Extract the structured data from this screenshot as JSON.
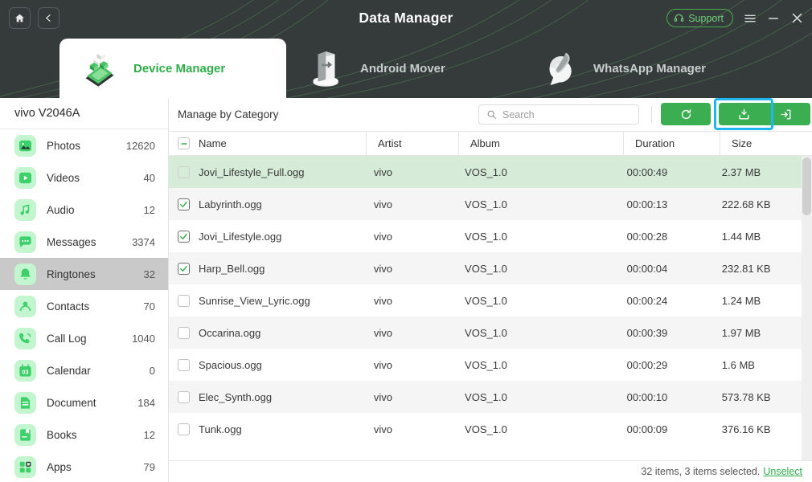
{
  "window": {
    "title": "Data Manager",
    "home_icon": "home-icon",
    "back_icon": "chevron-left-icon",
    "support_label": "Support",
    "support_icon": "headset-icon",
    "menu_icon": "hamburger-icon",
    "minimize_icon": "minimize-icon",
    "close_icon": "close-icon",
    "accent": "#3cae52",
    "header_bg": "#353a3b"
  },
  "tabs": [
    {
      "label": "Device Manager",
      "icon": "phone-cubes-icon",
      "active": true
    },
    {
      "label": "Android Mover",
      "icon": "folder-transfer-icon",
      "active": false
    },
    {
      "label": "WhatsApp Manager",
      "icon": "whatsapp-phone-icon",
      "active": false
    }
  ],
  "sidebar": {
    "device_name": "vivo V2046A",
    "items": [
      {
        "label": "Photos",
        "count": "12620",
        "icon": "photos-icon",
        "selected": false
      },
      {
        "label": "Videos",
        "count": "40",
        "icon": "videos-icon",
        "selected": false
      },
      {
        "label": "Audio",
        "count": "12",
        "icon": "audio-icon",
        "selected": false
      },
      {
        "label": "Messages",
        "count": "3374",
        "icon": "messages-icon",
        "selected": false
      },
      {
        "label": "Ringtones",
        "count": "32",
        "icon": "ringtones-icon",
        "selected": true
      },
      {
        "label": "Contacts",
        "count": "70",
        "icon": "contacts-icon",
        "selected": false
      },
      {
        "label": "Call Log",
        "count": "1040",
        "icon": "calllog-icon",
        "selected": false
      },
      {
        "label": "Calendar",
        "count": "0",
        "icon": "calendar-icon",
        "selected": false
      },
      {
        "label": "Document",
        "count": "184",
        "icon": "document-icon",
        "selected": false
      },
      {
        "label": "Books",
        "count": "12",
        "icon": "books-icon",
        "selected": false
      },
      {
        "label": "Apps",
        "count": "79",
        "icon": "apps-icon",
        "selected": false
      }
    ]
  },
  "toolbar": {
    "manage_label": "Manage by Category",
    "search": {
      "placeholder": "Search",
      "value": "",
      "icon": "search-icon"
    },
    "buttons": [
      {
        "name": "refresh-button",
        "icon": "refresh-icon",
        "focused": false
      },
      {
        "name": "export-button",
        "icon": "export-icon",
        "focused": true
      },
      {
        "name": "import-button",
        "icon": "import-icon",
        "focused": false
      }
    ]
  },
  "table": {
    "select_all_state": "indeterminate",
    "columns": [
      "Name",
      "Artist",
      "Album",
      "Duration",
      "Size"
    ],
    "rows": [
      {
        "name": "Jovi_Lifestyle_Full.ogg",
        "artist": "vivo",
        "album": "VOS_1.0",
        "duration": "00:00:49",
        "size": "2.37 MB",
        "checked": false,
        "hover": true
      },
      {
        "name": "Labyrinth.ogg",
        "artist": "vivo",
        "album": "VOS_1.0",
        "duration": "00:00:13",
        "size": "222.68 KB",
        "checked": true,
        "hover": false
      },
      {
        "name": "Jovi_Lifestyle.ogg",
        "artist": "vivo",
        "album": "VOS_1.0",
        "duration": "00:00:28",
        "size": "1.44 MB",
        "checked": true,
        "hover": false
      },
      {
        "name": "Harp_Bell.ogg",
        "artist": "vivo",
        "album": "VOS_1.0",
        "duration": "00:00:04",
        "size": "232.81 KB",
        "checked": true,
        "hover": false
      },
      {
        "name": "Sunrise_View_Lyric.ogg",
        "artist": "vivo",
        "album": "VOS_1.0",
        "duration": "00:00:24",
        "size": "1.24 MB",
        "checked": false,
        "hover": false
      },
      {
        "name": "Occarina.ogg",
        "artist": "vivo",
        "album": "VOS_1.0",
        "duration": "00:00:39",
        "size": "1.97 MB",
        "checked": false,
        "hover": false
      },
      {
        "name": "Spacious.ogg",
        "artist": "vivo",
        "album": "VOS_1.0",
        "duration": "00:00:29",
        "size": "1.6 MB",
        "checked": false,
        "hover": false
      },
      {
        "name": "Elec_Synth.ogg",
        "artist": "vivo",
        "album": "VOS_1.0",
        "duration": "00:00:10",
        "size": "573.78 KB",
        "checked": false,
        "hover": false
      },
      {
        "name": "Tunk.ogg",
        "artist": "vivo",
        "album": "VOS_1.0",
        "duration": "00:00:09",
        "size": "376.16 KB",
        "checked": false,
        "hover": false
      }
    ]
  },
  "footer": {
    "status": "32 items, 3 items selected.",
    "unselect_label": "Unselect"
  }
}
